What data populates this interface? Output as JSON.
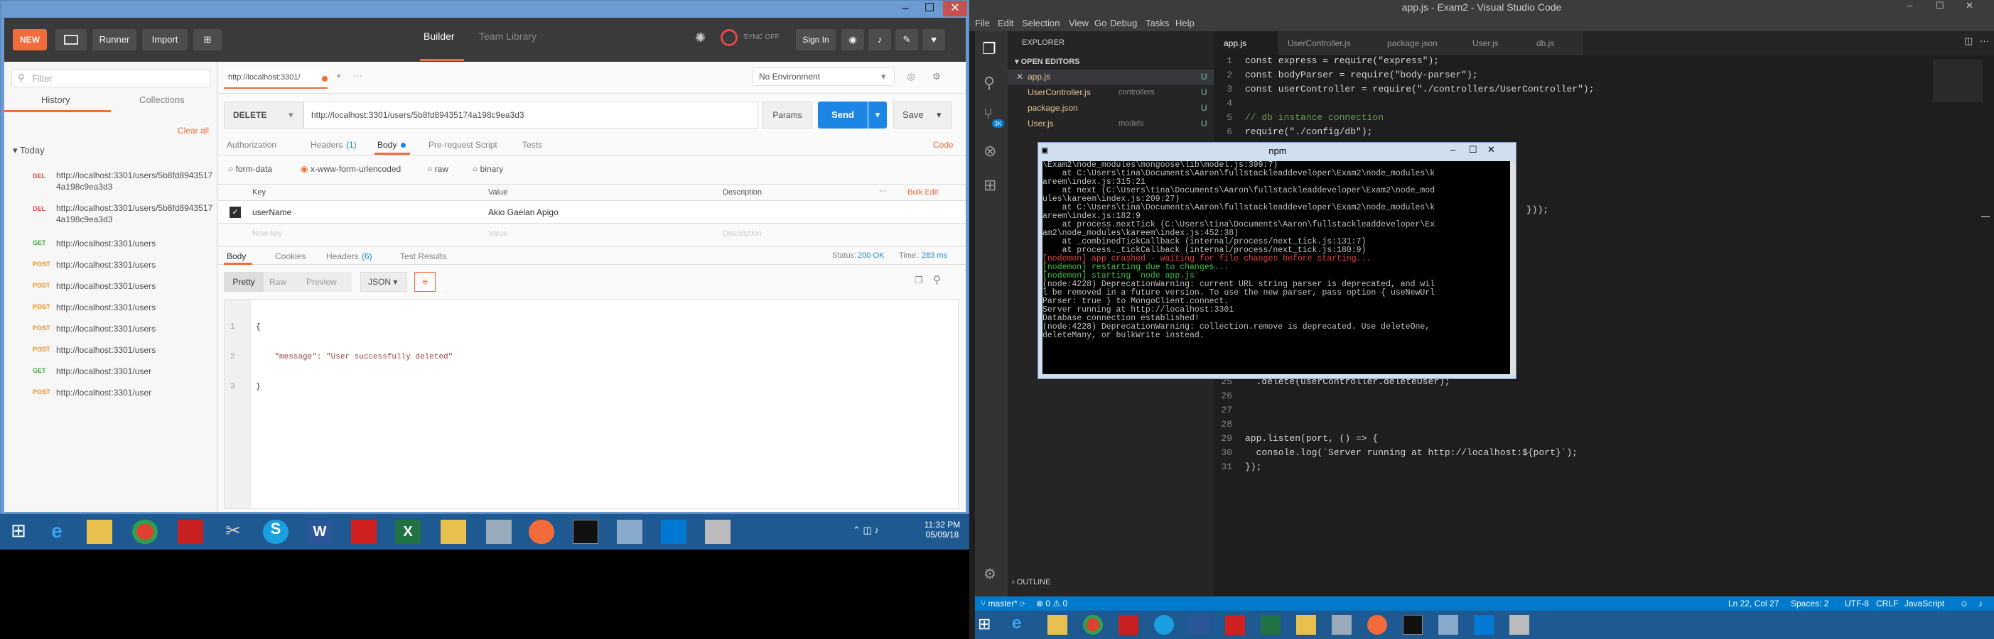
{
  "postman": {
    "window_controls": [
      "–",
      "☐",
      "✕"
    ],
    "new_label": "NEW",
    "runner_label": "Runner",
    "import_label": "Import",
    "builder_tab": "Builder",
    "team_library_tab": "Team Library",
    "sync_label": "SYNC OFF",
    "signin_label": "Sign In",
    "filter_placeholder": "Filter",
    "history_tab": "History",
    "collections_tab": "Collections",
    "clear_all": "Clear all",
    "today_label": "Today",
    "history": [
      {
        "method": "DEL",
        "color": "#e3494b",
        "url": "http://localhost:3301/users/5b8fd89435174a198c9ea3d3"
      },
      {
        "method": "DEL",
        "color": "#e3494b",
        "url": "http://localhost:3301/users/5b8fd89435174a198c9ea3d3"
      },
      {
        "method": "GET",
        "color": "#40a840",
        "url": "http://localhost:3301/users"
      },
      {
        "method": "POST",
        "color": "#f28c28",
        "url": "http://localhost:3301/users"
      },
      {
        "method": "POST",
        "color": "#f28c28",
        "url": "http://localhost:3301/users"
      },
      {
        "method": "POST",
        "color": "#f28c28",
        "url": "http://localhost:3301/users"
      },
      {
        "method": "POST",
        "color": "#f28c28",
        "url": "http://localhost:3301/users"
      },
      {
        "method": "POST",
        "color": "#f28c28",
        "url": "http://localhost:3301/users"
      },
      {
        "method": "GET",
        "color": "#40a840",
        "url": "http://localhost:3301/user"
      },
      {
        "method": "POST",
        "color": "#f28c28",
        "url": "http://localhost:3301/user"
      }
    ],
    "req_tab": "http://localhost:3301/",
    "environment": "No Environment",
    "method": "DELETE",
    "request_url": "http://localhost:3301/users/5b8fd89435174a198c9ea3d3",
    "params": "Params",
    "send": "Send",
    "save": "Save",
    "req_tabs": [
      "Authorization",
      "Headers",
      "(1)",
      "Body",
      "Pre-request Script",
      "Tests"
    ],
    "code_link": "Code",
    "body_types": [
      "form-data",
      "x-www-form-urlencoded",
      "raw",
      "binary"
    ],
    "kv_headers": [
      "Key",
      "Value",
      "Description"
    ],
    "bulk_edit": "Bulk Edit",
    "kv_row": {
      "key": "userName",
      "value": "Akio Gaelan Apigo"
    },
    "new_key": "New key",
    "new_value": "Value",
    "new_desc": "Description",
    "resp_tabs": [
      "Body",
      "Cookies",
      "Headers",
      "(6)",
      "Test Results"
    ],
    "status_label": "Status:",
    "status_value": "200 OK",
    "time_label": "Time:",
    "time_value": "283 ms",
    "view_tabs": [
      "Pretty",
      "Raw",
      "Preview"
    ],
    "format": "JSON",
    "resp_lines": [
      "1",
      "2",
      "3"
    ],
    "resp_code": [
      "{",
      "    \"message\": \"User successfully deleted\"",
      "}"
    ]
  },
  "taskbar": {
    "time": "11:32 PM",
    "date": "05/09/18"
  },
  "vscode": {
    "title": "app.js - Exam2 - Visual Studio Code",
    "menu": [
      "File",
      "Edit",
      "Selection",
      "View",
      "Go",
      "Debug",
      "Tasks",
      "Help"
    ],
    "explorer": "EXPLORER",
    "open_editors": "OPEN EDITORS",
    "open_files": [
      {
        "name": "app.js",
        "dir": "",
        "flag": "U"
      },
      {
        "name": "UserController.js",
        "dir": "controllers",
        "flag": "U"
      },
      {
        "name": "package.json",
        "dir": "",
        "flag": "U"
      },
      {
        "name": "User.js",
        "dir": "models",
        "flag": "U"
      }
    ],
    "outline": "OUTLINE",
    "tabs": [
      "app.js",
      "UserController.js",
      "package.json",
      "User.js",
      "db.js"
    ],
    "badge": "3K",
    "code_top": [
      {
        "n": "1",
        "t": "const express = require(\"express\");"
      },
      {
        "n": "2",
        "t": "const bodyParser = require(\"body-parser\");"
      },
      {
        "n": "3",
        "t": "const userController = require(\"./controllers/UserController\");"
      },
      {
        "n": "4",
        "t": ""
      },
      {
        "n": "5",
        "t": "// db instance connection"
      },
      {
        "n": "6",
        "t": "require(\"./config/db\");"
      }
    ],
    "code_mid": "}));",
    "code_bottom": [
      {
        "n": "25",
        "t": "  .delete(userController.deleteUser);"
      },
      {
        "n": "26",
        "t": ""
      },
      {
        "n": "27",
        "t": ""
      },
      {
        "n": "28",
        "t": ""
      },
      {
        "n": "29",
        "t": "app.listen(port, () => {"
      },
      {
        "n": "30",
        "t": "  console.log(`Server running at http://localhost:${port}`);"
      },
      {
        "n": "31",
        "t": "});"
      }
    ],
    "status": {
      "branch": "master*",
      "errors": "0",
      "warnings": "0",
      "position": "Ln 22, Col 27",
      "spaces": "Spaces: 2",
      "encoding": "UTF-8",
      "eol": "CRLF",
      "lang": "JavaScript"
    }
  },
  "npm": {
    "title": "npm",
    "lines": [
      {
        "c": "#c0c0c0",
        "t": "\\Exam2\\node_modules\\mongoose\\lib\\model.js:399:7)"
      },
      {
        "c": "#c0c0c0",
        "t": "    at C:\\Users\\tina\\Documents\\Aaron\\fullstackleaddeveloper\\Exam2\\node_modules\\k"
      },
      {
        "c": "#c0c0c0",
        "t": "areem\\index.js:315:21"
      },
      {
        "c": "#c0c0c0",
        "t": "    at next (C:\\Users\\tina\\Documents\\Aaron\\fullstackleaddeveloper\\Exam2\\node_mod"
      },
      {
        "c": "#c0c0c0",
        "t": "ules\\kareem\\index.js:209:27)"
      },
      {
        "c": "#c0c0c0",
        "t": "    at C:\\Users\\tina\\Documents\\Aaron\\fullstackleaddeveloper\\Exam2\\node_modules\\k"
      },
      {
        "c": "#c0c0c0",
        "t": "areem\\index.js:182:9"
      },
      {
        "c": "#c0c0c0",
        "t": "    at process.nextTick (C:\\Users\\tina\\Documents\\Aaron\\fullstackleaddeveloper\\Ex"
      },
      {
        "c": "#c0c0c0",
        "t": "am2\\node_modules\\kareem\\index.js:452:38)"
      },
      {
        "c": "#c0c0c0",
        "t": "    at _combinedTickCallback (internal/process/next_tick.js:131:7)"
      },
      {
        "c": "#c0c0c0",
        "t": "    at process._tickCallback (internal/process/next_tick.js:180:9)"
      },
      {
        "c": "#e04040",
        "t": "[nodemon] app crashed - waiting for file changes before starting..."
      },
      {
        "c": "#40c040",
        "t": "[nodemon] restarting due to changes..."
      },
      {
        "c": "#40c040",
        "t": "[nodemon] starting `node app.js`"
      },
      {
        "c": "#c0c0c0",
        "t": "(node:4228) DeprecationWarning: current URL string parser is deprecated, and wil"
      },
      {
        "c": "#c0c0c0",
        "t": "l be removed in a future version. To use the new parser, pass option { useNewUrl"
      },
      {
        "c": "#c0c0c0",
        "t": "Parser: true } to MongoClient.connect."
      },
      {
        "c": "#c0c0c0",
        "t": "Server running at http://localhost:3301"
      },
      {
        "c": "#c0c0c0",
        "t": "Database connection established!"
      },
      {
        "c": "#c0c0c0",
        "t": "(node:4228) DeprecationWarning: collection.remove is deprecated. Use deleteOne,"
      },
      {
        "c": "#c0c0c0",
        "t": "deleteMany, or bulkWrite instead."
      }
    ]
  },
  "colors": {
    "accent": "#f26b3a",
    "send": "#1d86e5",
    "vs_status": "#007acc"
  }
}
